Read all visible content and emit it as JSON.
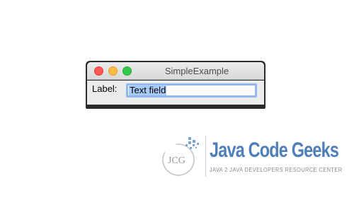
{
  "window": {
    "title": "SimpleExample",
    "controls": {
      "close": "close",
      "minimize": "minimize",
      "zoom": "zoom"
    }
  },
  "form": {
    "label": "Label:",
    "text_field_value": "Text field"
  },
  "watermark": {
    "monogram": "JCG",
    "brand": "Java Code Geeks",
    "tagline": "JAVA 2 JAVA DEVELOPERS RESOURCE CENTER"
  },
  "colors": {
    "close": "#fc5753",
    "minimize": "#fdbc40",
    "zoom": "#34c84a",
    "focus_ring": "#8fb8ee",
    "selection": "#a9cbf7",
    "brand": "#4f7fb8"
  }
}
